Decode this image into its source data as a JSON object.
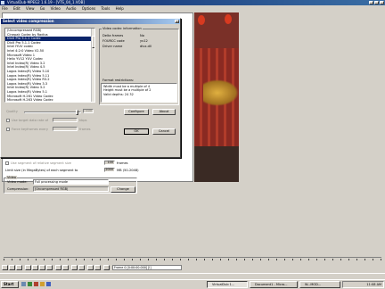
{
  "app": {
    "title": "VirtualDub-MPEG2 1.6.19 - [VTS_04_1.VOB]",
    "menu": [
      "File",
      "Edit",
      "View",
      "Go",
      "Video",
      "Audio",
      "Options",
      "Tools",
      "Help"
    ],
    "frame_readout": "Frame 0 [0:00:00.000] [I]"
  },
  "dialog": {
    "title": "Select video compression",
    "codecs": [
      "(Uncompressed RGB)",
      "Cinepak Codec by Radius",
      "DivX Pro 5.1.1 Codec",
      "DivX Pro 5.1.1 Codec",
      "Intel IYUV codec",
      "Intel 4:2:0 Video V2.50",
      "Microsoft Video 1",
      "Helix YV12 YUV Codec",
      "Intel Indeo(R) Video 3.2",
      "Intel Indeo(R) Video 4.5",
      "Logos Indeo(R) Video 5.10",
      "Logos Indeo(R) Video 5.11",
      "Logos Indeo(R) Video R3.2",
      "Logos Indeo(R) Video 3.3",
      "Intel Indeo(R) Video 3.2",
      "Logos Indeo(R) Video 5.1",
      "Microsoft H.261 Video Codec",
      "Microsoft H.263 Video Codec"
    ],
    "selected_index": 2,
    "info_group_label": "Video codec information",
    "info": [
      {
        "label": "Delta frames",
        "value": "No"
      },
      {
        "label": "FOURCC code",
        "value": "yv12"
      },
      {
        "label": "Driver name",
        "value": "divx.dll"
      }
    ],
    "restrictions_label": "Format restrictions:",
    "restrictions": [
      "Width must be a multiple of 4",
      "Height must be a multiple of 2",
      "Valid depths: 24 32"
    ],
    "quality_label": "Quality",
    "quality_value": "100",
    "keyframe_label": "Use target data rate of",
    "keyframe_value": "kbps",
    "force_label": "Force keyframes every",
    "force_value": "frames",
    "configure_label": "Configure",
    "about_label": "About",
    "ok_label": "OK",
    "cancel_label": "Cancel"
  },
  "behind": {
    "segment_label": "Use segment of relative segment size",
    "segment_unit": "frames",
    "segment_value": "100",
    "limit_label": "Limit size (in MegaBytes) of each segment to",
    "limit_value": "2000",
    "limit_unit": "MB (50-2048)",
    "video_group": "Video",
    "video_mode_label": "Video mode:",
    "video_mode_value": "Full processing mode",
    "compression_label": "Compression:",
    "compression_value": "(Uncompressed RGB)",
    "change_label": "Change"
  },
  "taskbar": {
    "start_label": "Start",
    "tasks": [
      "VirtualDub 1...",
      "Document1 - Micro...",
      "W...MOD..."
    ],
    "clock": "11:08 AM"
  }
}
